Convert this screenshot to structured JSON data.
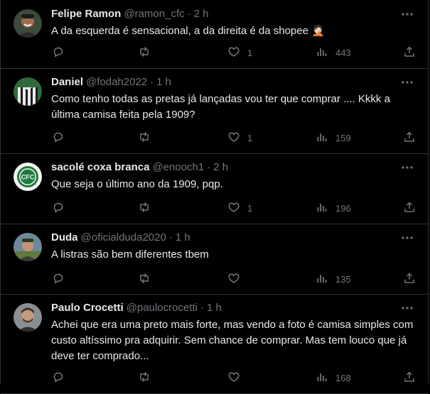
{
  "tweets": [
    {
      "name": "Felipe Ramon",
      "handle": "@ramon_cfc",
      "dot": "·",
      "time": "2 h",
      "text": "A da esquerda é sensacional, a da direita é da shopee 🤦🏻",
      "likes": "1",
      "views": "443"
    },
    {
      "name": "Daniel",
      "handle": "@fodah2022",
      "dot": "·",
      "time": "1 h",
      "text": "Como tenho todas as pretas já lançadas vou ter que comprar .... Kkkk a última camisa feita pela 1909?",
      "likes": "1",
      "views": "159"
    },
    {
      "name": "sacolé coxa branca",
      "handle": "@enooch1",
      "dot": "·",
      "time": "2 h",
      "text": "Que seja o último ano da 1909, pqp.",
      "likes": "1",
      "views": "196"
    },
    {
      "name": "Duda",
      "handle": "@oficialduda2020",
      "dot": "·",
      "time": "1 h",
      "text": "A listras são bem diferentes tbem",
      "likes": "",
      "views": "135"
    },
    {
      "name": "Paulo Crocetti",
      "handle": "@paulocrocetti",
      "dot": "·",
      "time": "1 h",
      "text": "Achei que era uma preto mais forte, mas vendo a foto é camisa simples com custo altíssimo pra adquirir. Sem chance de comprar. Mas tem louco que já deve ter comprado...",
      "likes": "",
      "views": "168"
    }
  ],
  "colors": {
    "background": "#000000",
    "text": "#e7e9ea",
    "secondary": "#71767b",
    "divider": "#2f3336"
  },
  "icons": [
    "reply-icon",
    "retweet-icon",
    "like-icon",
    "views-icon",
    "share-icon",
    "more-icon"
  ]
}
